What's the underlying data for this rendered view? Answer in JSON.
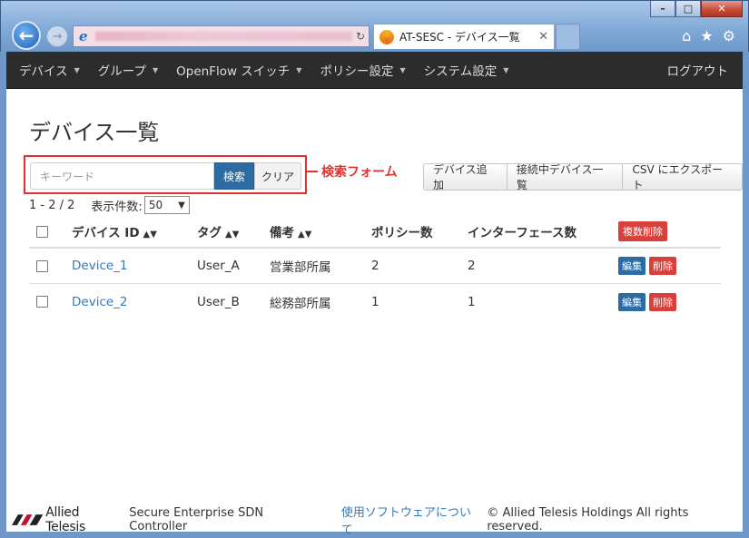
{
  "browser": {
    "tab_title": "AT-SESC - デバイス一覧"
  },
  "nav": {
    "items": [
      {
        "label": "デバイス"
      },
      {
        "label": "グループ"
      },
      {
        "label": "OpenFlow スイッチ"
      },
      {
        "label": "ポリシー設定"
      },
      {
        "label": "システム設定"
      }
    ],
    "logout": "ログアウト"
  },
  "page": {
    "title": "デバイス一覧"
  },
  "search": {
    "placeholder": "キーワード",
    "search_label": "検索",
    "clear_label": "クリア",
    "annotation": "検索フォーム"
  },
  "actions": {
    "add_device": "デバイス追加",
    "connected_list": "接続中デバイス一覧",
    "csv_export": "CSV にエクスポート"
  },
  "pager": {
    "range": "1 - 2 / 2",
    "per_page_label": "表示件数:",
    "per_page_value": "50"
  },
  "table": {
    "headers": {
      "device_id": "デバイス ID",
      "tag": "タグ",
      "note": "備考",
      "policies": "ポリシー数",
      "interfaces": "インターフェース数",
      "bulk_delete": "複数削除"
    },
    "rows": [
      {
        "device_id": "Device_1",
        "tag": "User_A",
        "note": "営業部所属",
        "policies": "2",
        "interfaces": "2",
        "edit": "編集",
        "delete": "削除"
      },
      {
        "device_id": "Device_2",
        "tag": "User_B",
        "note": "総務部所属",
        "policies": "1",
        "interfaces": "1",
        "edit": "編集",
        "delete": "削除"
      }
    ]
  },
  "footer": {
    "logo_text": "Allied Telesis",
    "product": "Secure Enterprise SDN Controller",
    "about_link": "使用ソフトウェアについて",
    "copyright": "© Allied Telesis Holdings All rights reserved."
  },
  "colors": {
    "primary": "#2d6ca2",
    "danger": "#d9403b",
    "navbar": "#2c2c2c",
    "link": "#3479b7",
    "annotation": "#e53030"
  }
}
